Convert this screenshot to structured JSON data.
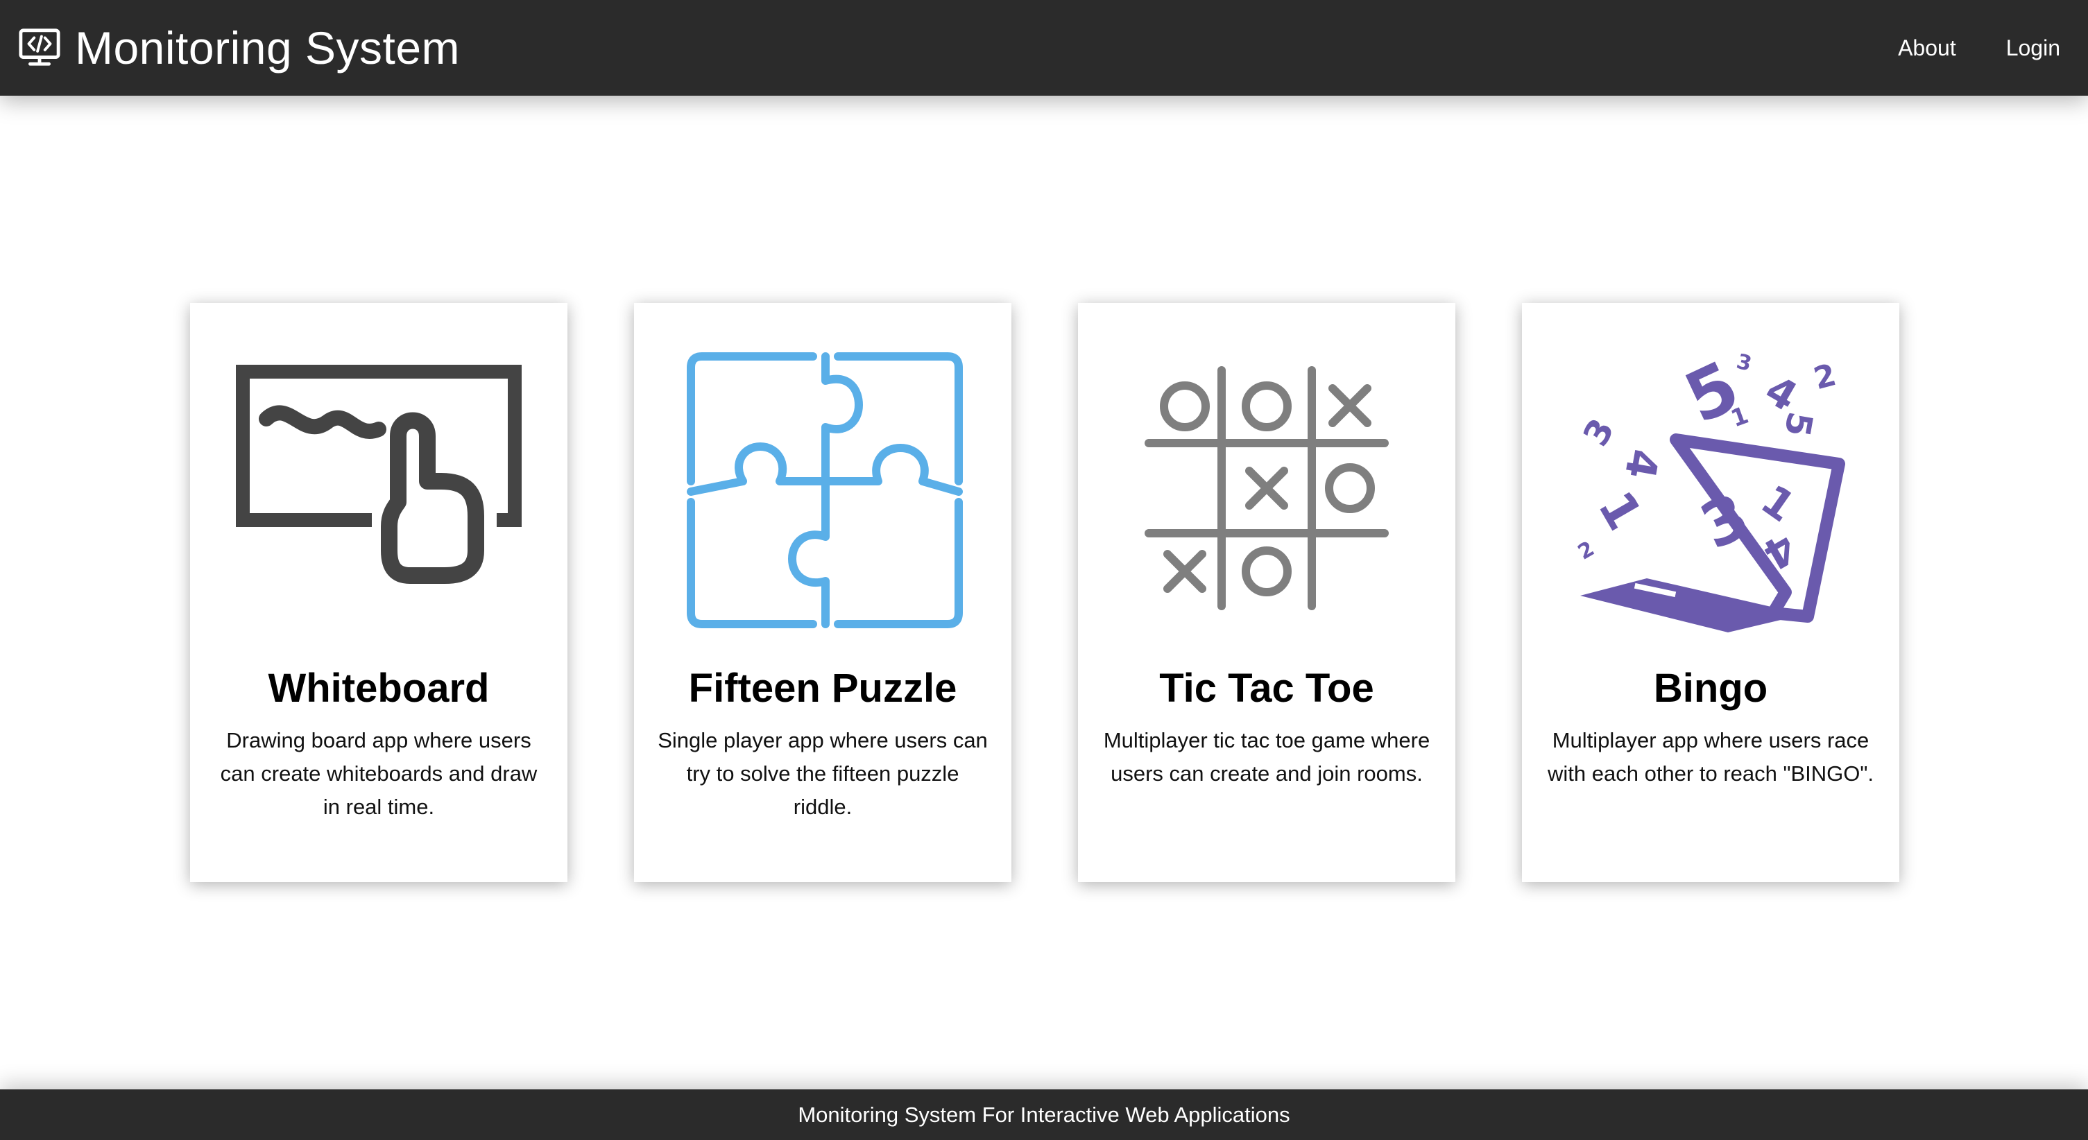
{
  "navbar": {
    "title": "Monitoring System",
    "brand_icon": "monitor-code-icon",
    "links": [
      {
        "label": "About"
      },
      {
        "label": "Login"
      }
    ]
  },
  "apps": [
    {
      "title": "Whiteboard",
      "description": "Drawing board app where users can create whiteboards and draw in real time.",
      "icon": "whiteboard-icon",
      "color": "#444444"
    },
    {
      "title": "Fifteen Puzzle",
      "description": "Single player app where users can try to solve the fifteen puzzle riddle.",
      "icon": "puzzle-icon",
      "color": "#5aafe8"
    },
    {
      "title": "Tic Tac Toe",
      "description": "Multiplayer tic tac toe game where users can create and join rooms.",
      "icon": "tic-tac-toe-icon",
      "color": "#7f7f7f"
    },
    {
      "title": "Bingo",
      "description": "Multiplayer app where users race with each other to reach \"BINGO\".",
      "icon": "bingo-laptop-icon",
      "color": "#6a5aad"
    }
  ],
  "footer": {
    "text": "Monitoring System For Interactive Web Applications"
  },
  "colors": {
    "navbar_bg": "#2b2b2b",
    "page_bg": "#ffffff"
  }
}
